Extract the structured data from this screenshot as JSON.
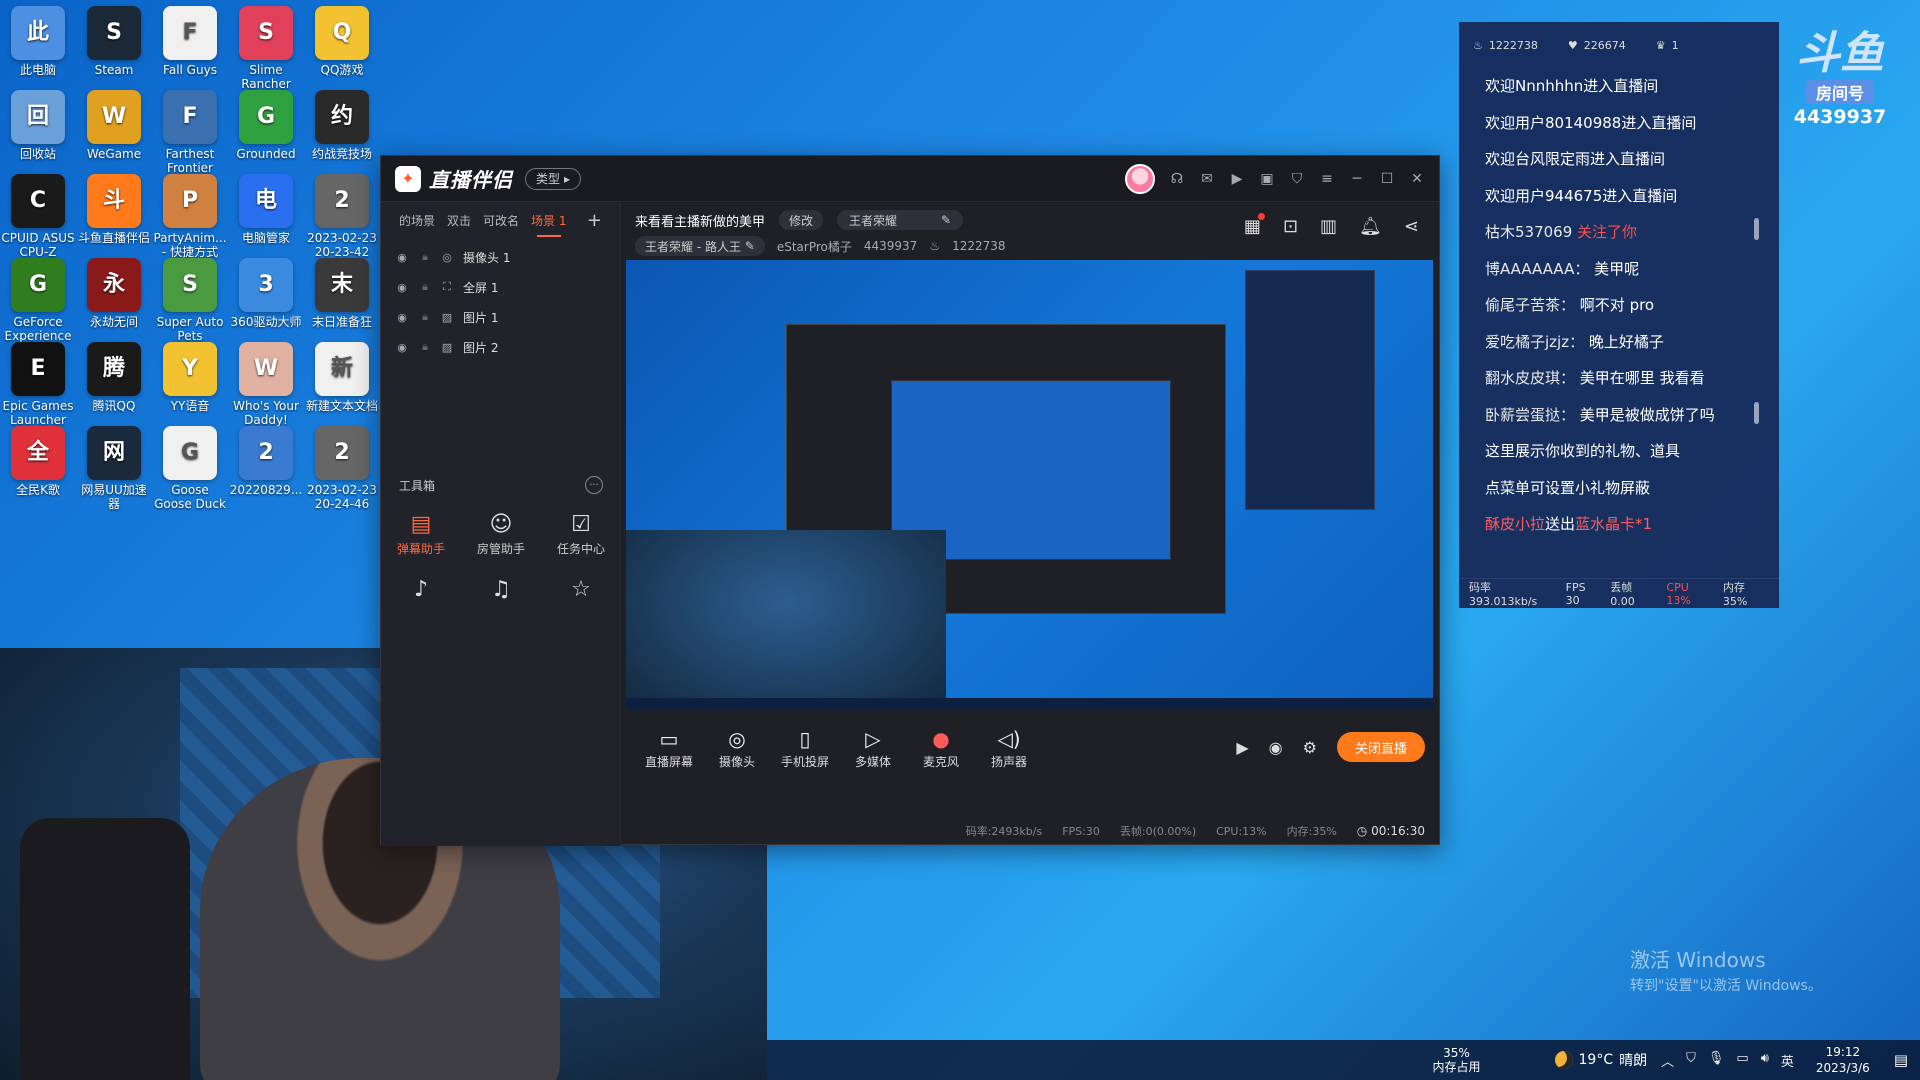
{
  "desktop": {
    "icons": [
      {
        "label": "此电脑",
        "icon": "computer-icon",
        "color": "#4d8fe0"
      },
      {
        "label": "Steam",
        "icon": "steam-icon",
        "color": "#1b2838"
      },
      {
        "label": "Fall Guys",
        "icon": "file-icon",
        "color": "#f0f0f0"
      },
      {
        "label": "Slime Rancher",
        "icon": "slime-icon",
        "color": "#e0405a"
      },
      {
        "label": "QQ游戏",
        "icon": "qq-penguin-icon",
        "color": "#f2c230"
      },
      {
        "label": "回收站",
        "icon": "recycle-bin-icon",
        "color": "#6aa0d8"
      },
      {
        "label": "WeGame",
        "icon": "wegame-icon",
        "color": "#e0a020"
      },
      {
        "label": "Farthest Frontier",
        "icon": "ff-icon",
        "color": "#3a6fb0"
      },
      {
        "label": "Grounded",
        "icon": "leaf-icon",
        "color": "#2fa040"
      },
      {
        "label": "约战竞技场",
        "icon": "arena-icon",
        "color": "#2a2a2a"
      },
      {
        "label": "CPUID ASUS CPU-Z",
        "icon": "cpu-icon",
        "color": "#1a1a1a"
      },
      {
        "label": "斗鱼直播伴侣",
        "icon": "douyu-icon",
        "color": "#ff7a1a"
      },
      {
        "label": "PartyAnim... - 快捷方式",
        "icon": "dog-icon",
        "color": "#d08040"
      },
      {
        "label": "电脑管家",
        "icon": "shield-icon",
        "color": "#2a6ff0"
      },
      {
        "label": "2023-02-23 20-23-42",
        "icon": "video-icon",
        "color": "#666"
      },
      {
        "label": "GeForce Experience",
        "icon": "nvidia-icon",
        "color": "#2f7d1f"
      },
      {
        "label": "永劫无间",
        "icon": "naraka-icon",
        "color": "#8a1a1a"
      },
      {
        "label": "Super Auto Pets",
        "icon": "turtle-icon",
        "color": "#4a9a40"
      },
      {
        "label": "360驱动大师",
        "icon": "gear-icon",
        "color": "#3a8ae0"
      },
      {
        "label": "末日准备狂",
        "icon": "gas-mask-icon",
        "color": "#3a3a3a"
      },
      {
        "label": "Epic Games Launcher",
        "icon": "epic-icon",
        "color": "#111"
      },
      {
        "label": "腾讯QQ",
        "icon": "qq-icon",
        "color": "#1a1a1a"
      },
      {
        "label": "YY语音",
        "icon": "yy-icon",
        "color": "#f2c230"
      },
      {
        "label": "Who's Your Daddy!",
        "icon": "baby-icon",
        "color": "#e0b0a0"
      },
      {
        "label": "新建文本文档",
        "icon": "text-doc-icon",
        "color": "#f0f0f0"
      },
      {
        "label": "全民K歌",
        "icon": "mic-bird-icon",
        "color": "#e0303a"
      },
      {
        "label": "网易UU加速器",
        "icon": "uu-icon",
        "color": "#1a2a3a"
      },
      {
        "label": "Goose Goose Duck",
        "icon": "goose-icon",
        "color": "#f0f0f0"
      },
      {
        "label": "20220829...",
        "icon": "file-icon",
        "color": "#3a7ad0"
      },
      {
        "label": "2023-02-23 20-24-46",
        "icon": "video-icon",
        "color": "#666"
      }
    ]
  },
  "app": {
    "title": "直播伴侣",
    "type_label": "类型",
    "scene_tabs": [
      "的场景",
      "双击",
      "可改名",
      "场景 1"
    ],
    "sources": [
      {
        "label": "摄像头 1",
        "kind": "camera-icon"
      },
      {
        "label": "全屏 1",
        "kind": "fullscreen-icon"
      },
      {
        "label": "图片 1",
        "kind": "image-icon"
      },
      {
        "label": "图片 2",
        "kind": "image-icon"
      }
    ],
    "toolbox_label": "工具箱",
    "tools": [
      {
        "label": "弹幕助手",
        "icon": "danmu-icon",
        "active": true
      },
      {
        "label": "房管助手",
        "icon": "admin-icon",
        "active": false
      },
      {
        "label": "任务中心",
        "icon": "task-icon",
        "active": false
      }
    ],
    "room_title": "来看看主播新做的美甲",
    "edit_label": "修改",
    "game_name": "王者荣耀",
    "category": "王者荣耀 - 路人王",
    "streamer": "eStarPro橘子",
    "room_id": "4439937",
    "heat": "1222738",
    "bottom_controls": [
      {
        "label": "直播屏幕",
        "icon": "screen-icon"
      },
      {
        "label": "摄像头",
        "icon": "camera-icon"
      },
      {
        "label": "手机投屏",
        "icon": "phone-cast-icon"
      },
      {
        "label": "多媒体",
        "icon": "media-icon"
      },
      {
        "label": "麦克风",
        "icon": "microphone-icon"
      },
      {
        "label": "扬声器",
        "icon": "speaker-icon"
      }
    ],
    "end_button": "关闭直播",
    "status": {
      "bitrate": "码率:2493kb/s",
      "fps": "FPS:30",
      "drop": "丢帧:0(0.00%)",
      "cpu": "CPU:13%",
      "mem": "内存:35%",
      "timer": "00:16:30"
    }
  },
  "chat": {
    "stats": {
      "heat": "1222738",
      "likes": "226674",
      "crown": "1"
    },
    "messages": [
      {
        "text": "欢迎Nnnhhhn进入直播间",
        "kind": "welcome"
      },
      {
        "text": "欢迎用户80140988进入直播间",
        "kind": "welcome"
      },
      {
        "text": "欢迎台风限定雨进入直播间",
        "kind": "welcome"
      },
      {
        "text": "欢迎用户944675进入直播间",
        "kind": "welcome"
      },
      {
        "name": "枯木537069",
        "text": "关注了你",
        "kind": "follow"
      },
      {
        "name": "博AAAAAAA：",
        "text": "美甲呢",
        "kind": "chat"
      },
      {
        "name": "偷尾子苦茶：",
        "text": "啊不对 pro",
        "kind": "chat"
      },
      {
        "name": "爱吃橘子jzjz：",
        "text": "晚上好橘子",
        "kind": "chat"
      },
      {
        "name": "翻水皮皮琪：",
        "text": "美甲在哪里 我看看",
        "kind": "chat"
      },
      {
        "name": "卧薪尝蛋挞：",
        "text": "美甲是被做成饼了吗",
        "kind": "chat"
      },
      {
        "text": "这里展示你收到的礼物、道具",
        "kind": "system"
      },
      {
        "text": "点菜单可设置小礼物屏蔽",
        "kind": "system"
      },
      {
        "name": "酥皮小拉",
        "mid": "送出",
        "gift": "蓝水晶卡*1",
        "kind": "gift"
      }
    ],
    "footer": {
      "bitrate": "码率 393.013kb/s",
      "fps": "FPS 30",
      "drop": "丢帧 0.00",
      "cpu": "CPU 13%",
      "mem": "内存 35%"
    }
  },
  "badge": {
    "logo": "斗鱼",
    "label": "房间号",
    "number": "4439937"
  },
  "watermark": {
    "line1": "激活 Windows",
    "line2": "转到\"设置\"以激活 Windows。"
  },
  "taskbar": {
    "mem_pct": "35%",
    "mem_label": "内存占用",
    "temp": "19°C",
    "weather": "晴朗",
    "ime": "英",
    "time": "19:12",
    "date": "2023/3/6"
  }
}
